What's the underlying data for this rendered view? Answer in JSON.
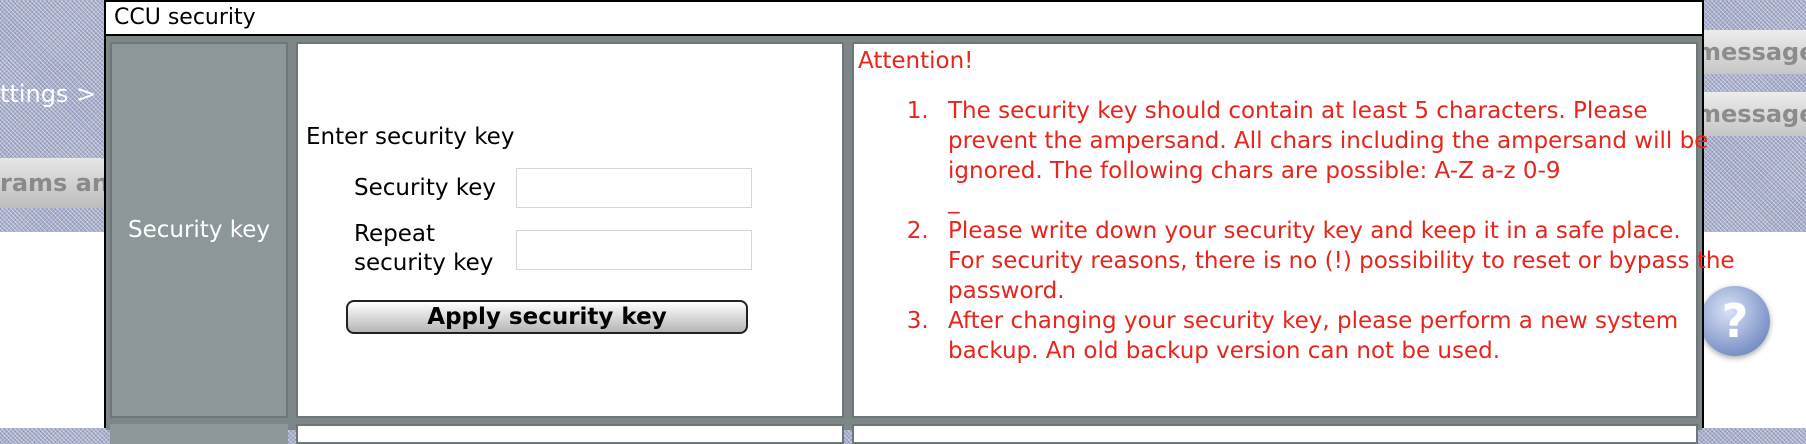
{
  "background": {
    "settings_fragment": "ttings >",
    "programs_fragment": "rams and",
    "message_tab_1": "message",
    "message_tab_2": "message",
    "help_glyph": "?"
  },
  "dialog": {
    "title": "CCU security",
    "row_label": "Security key",
    "form": {
      "heading": "Enter security key",
      "key_label": "Security key",
      "key_value": "",
      "repeat_label_line1": "Repeat",
      "repeat_label_line2": "security key",
      "repeat_value": "",
      "apply_button": "Apply security key"
    },
    "notes": {
      "heading": "Attention!",
      "item1": "The security key should contain at least 5 characters. Please prevent the ampersand. All chars including the ampersand will be ignored. The following chars are possible: A-Z a-z 0-9",
      "item1_extra": "_",
      "item2_line1": "Please write down your security key and keep it in a safe place.",
      "item2_line2": "For security reasons, there is no (!) possibility to reset or bypass the password.",
      "item3": "After changing your security key, please perform a new system backup. An old backup version can not be used."
    }
  },
  "colors": {
    "attention_red": "#e8251c",
    "label_cell_gray": "#8c979a",
    "table_border_gray": "#7d8788"
  },
  "icons": {
    "help": "help-icon"
  }
}
